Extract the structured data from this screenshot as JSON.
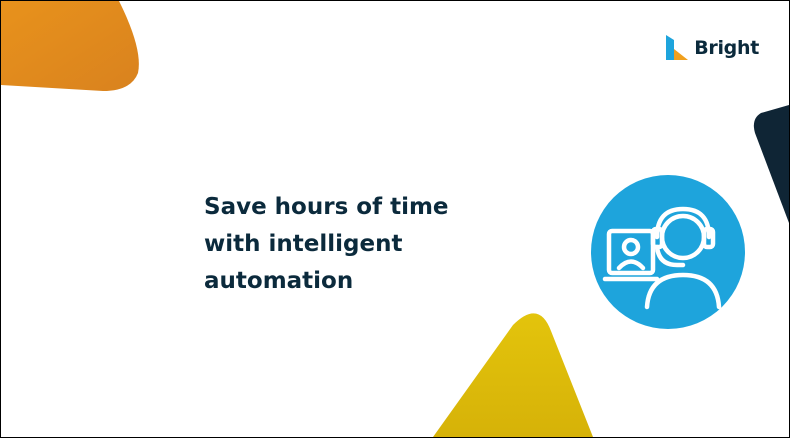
{
  "brand": {
    "name": "Bright",
    "logo_icon": "bright-logo-icon",
    "colors": {
      "text": "#0b2a3c",
      "mark_blue": "#1ea4dc",
      "mark_orange": "#f0a01e"
    }
  },
  "slide": {
    "headline_lines": [
      "Save hours of time",
      "with intelligent",
      "automation"
    ],
    "icon": "customer-support-agent-icon",
    "colors": {
      "icon_circle": "#1ea4dc",
      "orange_shape": "#e8901e",
      "yellow_shape": "#e0c20a",
      "navy_shape": "#0f2535"
    }
  }
}
